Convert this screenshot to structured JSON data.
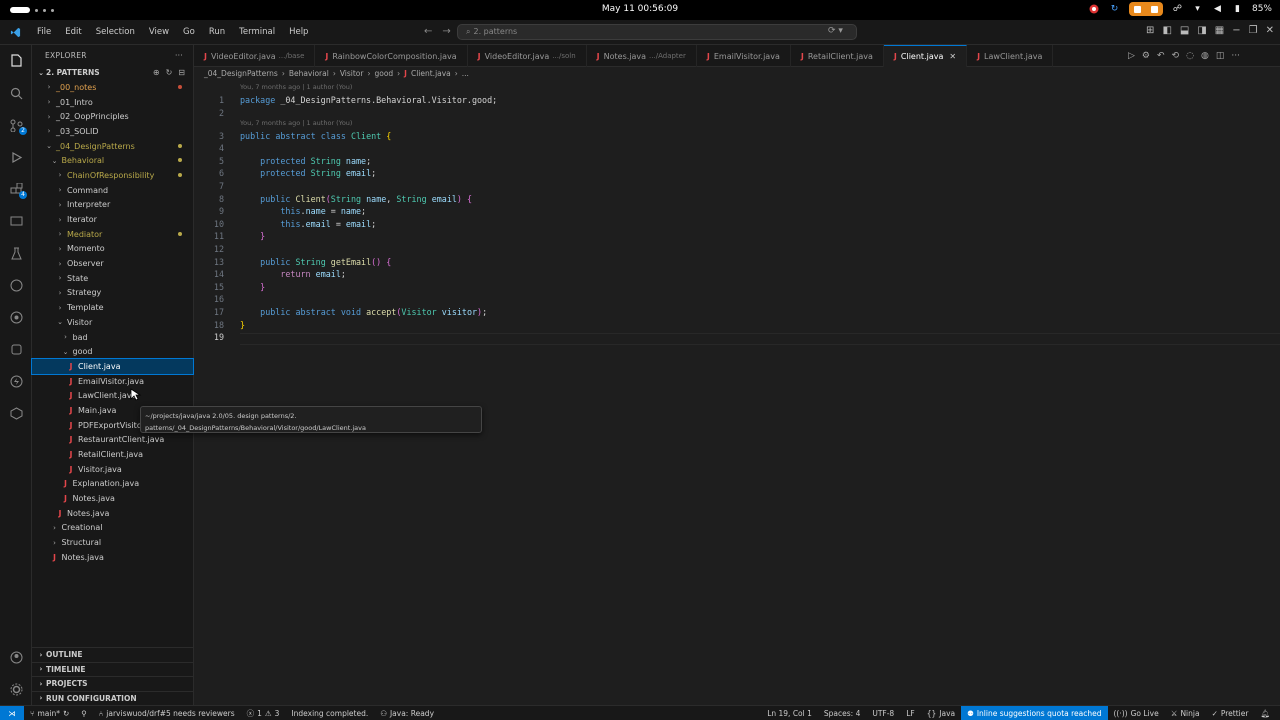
{
  "os": {
    "clock": "May 11  00:56:09",
    "battery": "85%"
  },
  "menu": [
    "File",
    "Edit",
    "Selection",
    "View",
    "Go",
    "Run",
    "Terminal",
    "Help"
  ],
  "command_center": {
    "placeholder": "2. patterns"
  },
  "sidebar": {
    "title": "EXPLORER",
    "root": "2. PATTERNS",
    "tree": [
      {
        "label": "_00_notes",
        "depth": 0,
        "kind": "folder",
        "open": false,
        "color": "orange",
        "dot": "#c74e39"
      },
      {
        "label": "_01_Intro",
        "depth": 0,
        "kind": "folder",
        "open": false,
        "color": "",
        "dot": ""
      },
      {
        "label": "_02_OopPrinciples",
        "depth": 0,
        "kind": "folder",
        "open": false,
        "color": "",
        "dot": ""
      },
      {
        "label": "_03_SOLID",
        "depth": 0,
        "kind": "folder",
        "open": false,
        "color": "",
        "dot": ""
      },
      {
        "label": "_04_DesignPatterns",
        "depth": 0,
        "kind": "folder",
        "open": true,
        "color": "yellow",
        "dot": "#b9a94a"
      },
      {
        "label": "Behavioral",
        "depth": 1,
        "kind": "folder",
        "open": true,
        "color": "yellow",
        "dot": "#b9a94a"
      },
      {
        "label": "ChainOfResponsibility",
        "depth": 2,
        "kind": "folder",
        "open": false,
        "color": "yellow",
        "dot": "#b9a94a"
      },
      {
        "label": "Command",
        "depth": 2,
        "kind": "folder",
        "open": false,
        "color": "",
        "dot": ""
      },
      {
        "label": "Interpreter",
        "depth": 2,
        "kind": "folder",
        "open": false,
        "color": "",
        "dot": ""
      },
      {
        "label": "Iterator",
        "depth": 2,
        "kind": "folder",
        "open": false,
        "color": "",
        "dot": ""
      },
      {
        "label": "Mediator",
        "depth": 2,
        "kind": "folder",
        "open": false,
        "color": "yellow",
        "dot": "#b9a94a"
      },
      {
        "label": "Momento",
        "depth": 2,
        "kind": "folder",
        "open": false,
        "color": "",
        "dot": ""
      },
      {
        "label": "Observer",
        "depth": 2,
        "kind": "folder",
        "open": false,
        "color": "",
        "dot": ""
      },
      {
        "label": "State",
        "depth": 2,
        "kind": "folder",
        "open": false,
        "color": "",
        "dot": ""
      },
      {
        "label": "Strategy",
        "depth": 2,
        "kind": "folder",
        "open": false,
        "color": "",
        "dot": ""
      },
      {
        "label": "Template",
        "depth": 2,
        "kind": "folder",
        "open": false,
        "color": "",
        "dot": ""
      },
      {
        "label": "Visitor",
        "depth": 2,
        "kind": "folder",
        "open": true,
        "color": "",
        "dot": ""
      },
      {
        "label": "bad",
        "depth": 3,
        "kind": "folder",
        "open": false,
        "color": "",
        "dot": ""
      },
      {
        "label": "good",
        "depth": 3,
        "kind": "folder",
        "open": true,
        "color": "",
        "dot": ""
      },
      {
        "label": "Client.java",
        "depth": 4,
        "kind": "file",
        "selected": true,
        "color": "",
        "dot": ""
      },
      {
        "label": "EmailVisitor.java",
        "depth": 4,
        "kind": "file",
        "color": "",
        "dot": ""
      },
      {
        "label": "LawClient.java",
        "depth": 4,
        "kind": "file",
        "color": "",
        "dot": ""
      },
      {
        "label": "Main.java",
        "depth": 4,
        "kind": "file",
        "color": "",
        "dot": ""
      },
      {
        "label": "PDFExportVisito",
        "depth": 4,
        "kind": "file",
        "color": "",
        "dot": ""
      },
      {
        "label": "RestaurantClient.java",
        "depth": 4,
        "kind": "file",
        "color": "",
        "dot": ""
      },
      {
        "label": "RetailClient.java",
        "depth": 4,
        "kind": "file",
        "color": "",
        "dot": ""
      },
      {
        "label": "Visitor.java",
        "depth": 4,
        "kind": "file",
        "color": "",
        "dot": ""
      },
      {
        "label": "Explanation.java",
        "depth": 3,
        "kind": "file",
        "color": "",
        "dot": ""
      },
      {
        "label": "Notes.java",
        "depth": 3,
        "kind": "file",
        "color": "",
        "dot": ""
      },
      {
        "label": "Notes.java",
        "depth": 2,
        "kind": "file",
        "color": "",
        "dot": ""
      },
      {
        "label": "Creational",
        "depth": 1,
        "kind": "folder",
        "open": false,
        "color": "",
        "dot": ""
      },
      {
        "label": "Structural",
        "depth": 1,
        "kind": "folder",
        "open": false,
        "color": "",
        "dot": ""
      },
      {
        "label": "Notes.java",
        "depth": 1,
        "kind": "file",
        "color": "",
        "dot": ""
      }
    ],
    "bottom_sections": [
      "OUTLINE",
      "TIMELINE",
      "PROJECTS",
      "RUN CONFIGURATION"
    ]
  },
  "tabs": [
    {
      "label": "VideoEditor.java",
      "desc": ".../base",
      "active": false
    },
    {
      "label": "RainbowColorComposition.java",
      "desc": "",
      "active": false
    },
    {
      "label": "VideoEditor.java",
      "desc": ".../soln",
      "active": false
    },
    {
      "label": "Notes.java",
      "desc": ".../Adapter",
      "active": false
    },
    {
      "label": "EmailVisitor.java",
      "desc": "",
      "active": false
    },
    {
      "label": "RetailClient.java",
      "desc": "",
      "active": false
    },
    {
      "label": "Client.java",
      "desc": "",
      "active": true
    },
    {
      "label": "LawClient.java",
      "desc": "",
      "active": false
    }
  ],
  "breadcrumb": [
    "_04_DesignPatterns",
    "Behavioral",
    "Visitor",
    "good",
    "Client.java",
    "..."
  ],
  "editor": {
    "lens1": "You, 7 months ago | 1 author (You)",
    "lens2": "You, 7 months ago | 1 author (You)",
    "line_numbers": [
      "1",
      "2",
      "3",
      "4",
      "5",
      "6",
      "7",
      "8",
      "9",
      "10",
      "11",
      "12",
      "13",
      "14",
      "15",
      "16",
      "17",
      "18",
      "19"
    ]
  },
  "tooltip": {
    "line1": "~/projects/java/java 2.0/05. design patterns/2.",
    "line2": "patterns/_04_DesignPatterns/Behavioral/Visitor/good/LawClient.java"
  },
  "status": {
    "branch": "main*",
    "pr": "jarviswuod/drf#5 needs reviewers",
    "problems_errors": "1",
    "problems_warnings": "3",
    "indexing": "Indexing completed.",
    "java_ready": "Java: Ready",
    "position": "Ln 19, Col 1",
    "spaces": "Spaces: 4",
    "encoding": "UTF-8",
    "eol": "LF",
    "language": "Java",
    "suggestions": "Inline suggestions quota reached",
    "golive": "Go Live",
    "ninja": "Ninja",
    "prettier": "Prettier"
  }
}
